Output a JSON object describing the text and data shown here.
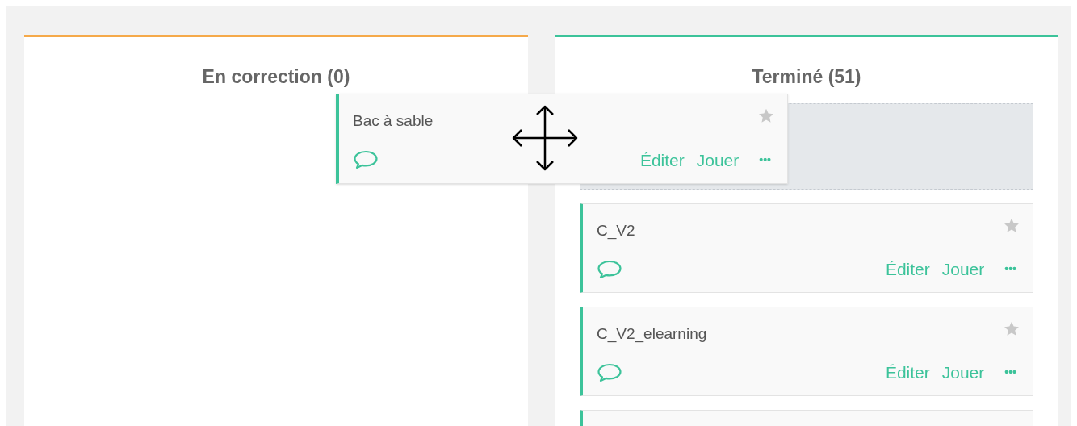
{
  "columns": [
    {
      "title": "En correction (0)",
      "color": "#f5a94a"
    },
    {
      "title": "Terminé (51)",
      "color": "#3cc39a",
      "placeholder": true,
      "cards": [
        {
          "kind": "card",
          "title": "C_V2",
          "starred": false,
          "actions": [
            "Éditer",
            "Jouer",
            "•••"
          ]
        },
        {
          "kind": "card",
          "title": "C_V2_elearning",
          "starred": false,
          "actions": [
            "Éditer",
            "Jouer",
            "•••"
          ]
        },
        {
          "kind": "partial"
        }
      ]
    }
  ],
  "dragged_card": {
    "title": "Bac à sable",
    "starred": false,
    "actions": [
      "Éditer",
      "Jouer",
      "•••"
    ]
  }
}
